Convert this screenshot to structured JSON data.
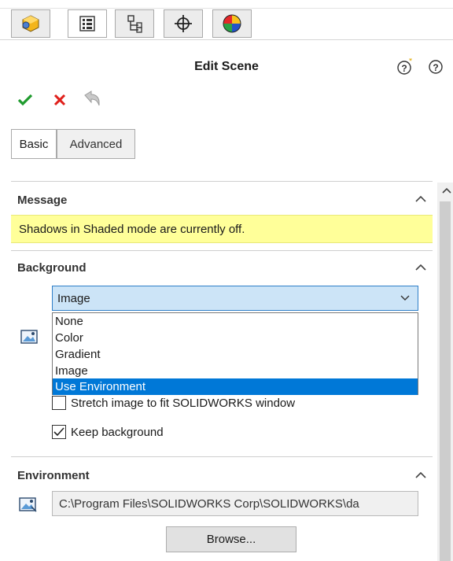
{
  "header": {
    "tabs": [
      {
        "icon": "feature-manager-icon"
      },
      {
        "icon": "property-manager-icon"
      },
      {
        "icon": "configuration-manager-icon"
      },
      {
        "icon": "dimxpert-manager-icon"
      },
      {
        "icon": "display-manager-icon"
      }
    ]
  },
  "panel": {
    "title": "Edit Scene",
    "help_icons": [
      "?*",
      "?"
    ]
  },
  "subtabs": {
    "basic": "Basic",
    "advanced": "Advanced"
  },
  "message": {
    "title": "Message",
    "text": "Shadows in Shaded mode are currently off."
  },
  "background": {
    "title": "Background",
    "selected": "Image",
    "options": [
      "None",
      "Color",
      "Gradient",
      "Image",
      "Use Environment"
    ],
    "highlighted_index": 4,
    "stretch_label": "Stretch image to fit SOLIDWORKS window",
    "keep_label": "Keep background",
    "keep_checked": true,
    "stretch_checked": false
  },
  "environment": {
    "title": "Environment",
    "path": "C:\\Program Files\\SOLIDWORKS Corp\\SOLIDWORKS\\da",
    "browse_label": "Browse..."
  },
  "colors": {
    "accept": "#1f9b2e",
    "cancel": "#e0201b",
    "highlight": "#0078d7",
    "message_bg": "#ffff99"
  }
}
